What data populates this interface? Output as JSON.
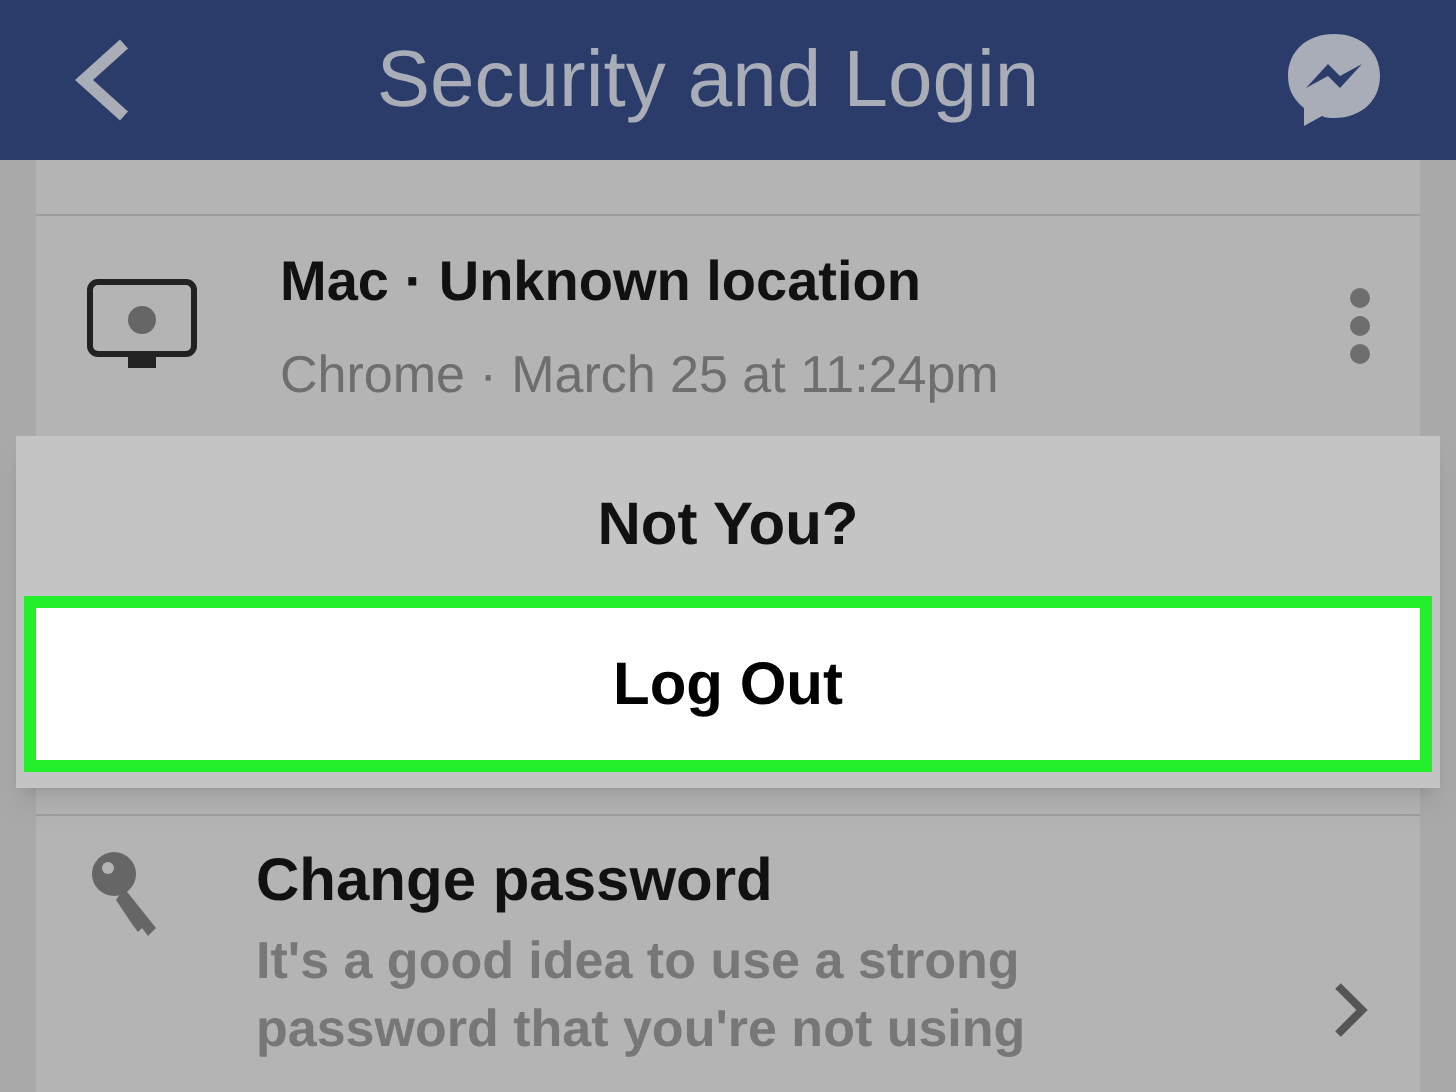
{
  "header": {
    "title": "Security and Login"
  },
  "session": {
    "device": "Mac · Unknown location",
    "details": "Chrome · March 25 at 11:24pm"
  },
  "menu": [
    {
      "label": "Not You?",
      "highlighted": false
    },
    {
      "label": "Log Out",
      "highlighted": true
    }
  ],
  "settings": [
    {
      "title": "Change password",
      "description": "It's a good idea to use a strong password that you're not using"
    }
  ]
}
